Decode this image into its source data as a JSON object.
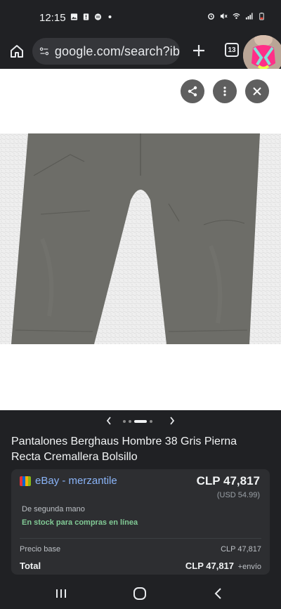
{
  "status_bar": {
    "time": "12:15"
  },
  "browser": {
    "url": "google.com/search?ib",
    "tab_count": "13"
  },
  "product": {
    "title": "Pantalones Berghaus Hombre 38 Gris Pierna Recta Cremallera Bolsillo",
    "image_index": 2,
    "image_count": 4
  },
  "offer": {
    "seller": "eBay - merzantile",
    "price": "CLP 47,817",
    "usd_price": "(USD 54.99)",
    "condition": "De segunda mano",
    "stock": "En stock para compras en línea",
    "base_label": "Precio base",
    "base_value": "CLP 47,817",
    "total_label": "Total",
    "total_value": "CLP 47,817",
    "shipping": "+envío"
  },
  "colors": {
    "link": "#8ab4f8",
    "in_stock": "#81c995",
    "pants": "#6d6d68"
  },
  "icons": [
    "home-icon",
    "site-settings-icon",
    "plus-icon",
    "tabs-icon",
    "share-icon",
    "more-vert-icon",
    "close-icon",
    "chevron-left-icon",
    "chevron-right-icon",
    "recents-icon",
    "home-nav-icon",
    "back-icon"
  ]
}
